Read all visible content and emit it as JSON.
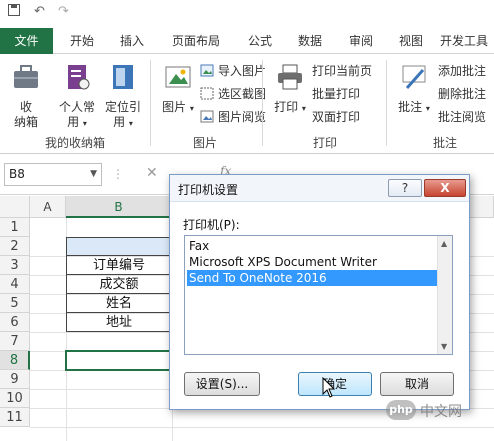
{
  "ribbon": {
    "tabs": [
      "文件",
      "开始",
      "插入",
      "页面布局",
      "公式",
      "数据",
      "审阅",
      "视图",
      "开发工具"
    ],
    "groups": {
      "my_box": {
        "label": "我的收纳箱",
        "btn_box_line1": "收",
        "btn_box_line2": "纳箱",
        "btn_personal_line1": "个人常",
        "btn_personal_line2": "用",
        "btn_locate_line1": "定位引",
        "btn_locate_line2": "用"
      },
      "image": {
        "label": "图片",
        "btn_image": "图片",
        "import": "导入图片",
        "screenshot": "选区截图",
        "preview": "图片阅览"
      },
      "print": {
        "label": "打印",
        "btn_print": "打印",
        "current": "打印当前页",
        "batch": "批量打印",
        "duplex": "双面打印"
      },
      "comment": {
        "label": "批注",
        "btn_comment": "批注",
        "add": "添加批注",
        "delete": "删除批注",
        "review": "批注阅览"
      }
    }
  },
  "formula_bar": {
    "name_box": "B8",
    "fx": "fx"
  },
  "grid": {
    "columns": [
      "A",
      "B"
    ],
    "rows": [
      "1",
      "2",
      "3",
      "4",
      "5",
      "6",
      "7",
      "8",
      "9",
      "10",
      "11"
    ],
    "active_cell": "B8",
    "cells": {
      "B3": "订单编号",
      "B4": "成交额",
      "B5": "姓名",
      "B6": "地址"
    }
  },
  "dialog": {
    "title": "打印机设置",
    "help": "?",
    "close": "X",
    "printer_label": "打印机(P):",
    "printers": [
      "Fax",
      "Microsoft XPS Document Writer",
      "Send To OneNote 2016"
    ],
    "selected_index": 2,
    "btn_settings": "设置(S)...",
    "btn_ok": "确定",
    "btn_cancel": "取消"
  },
  "watermark": {
    "logo": "php",
    "text": "中文网"
  },
  "colors": {
    "excel_green": "#217346",
    "selection_blue": "#3399ff",
    "close_red": "#c6442f"
  }
}
